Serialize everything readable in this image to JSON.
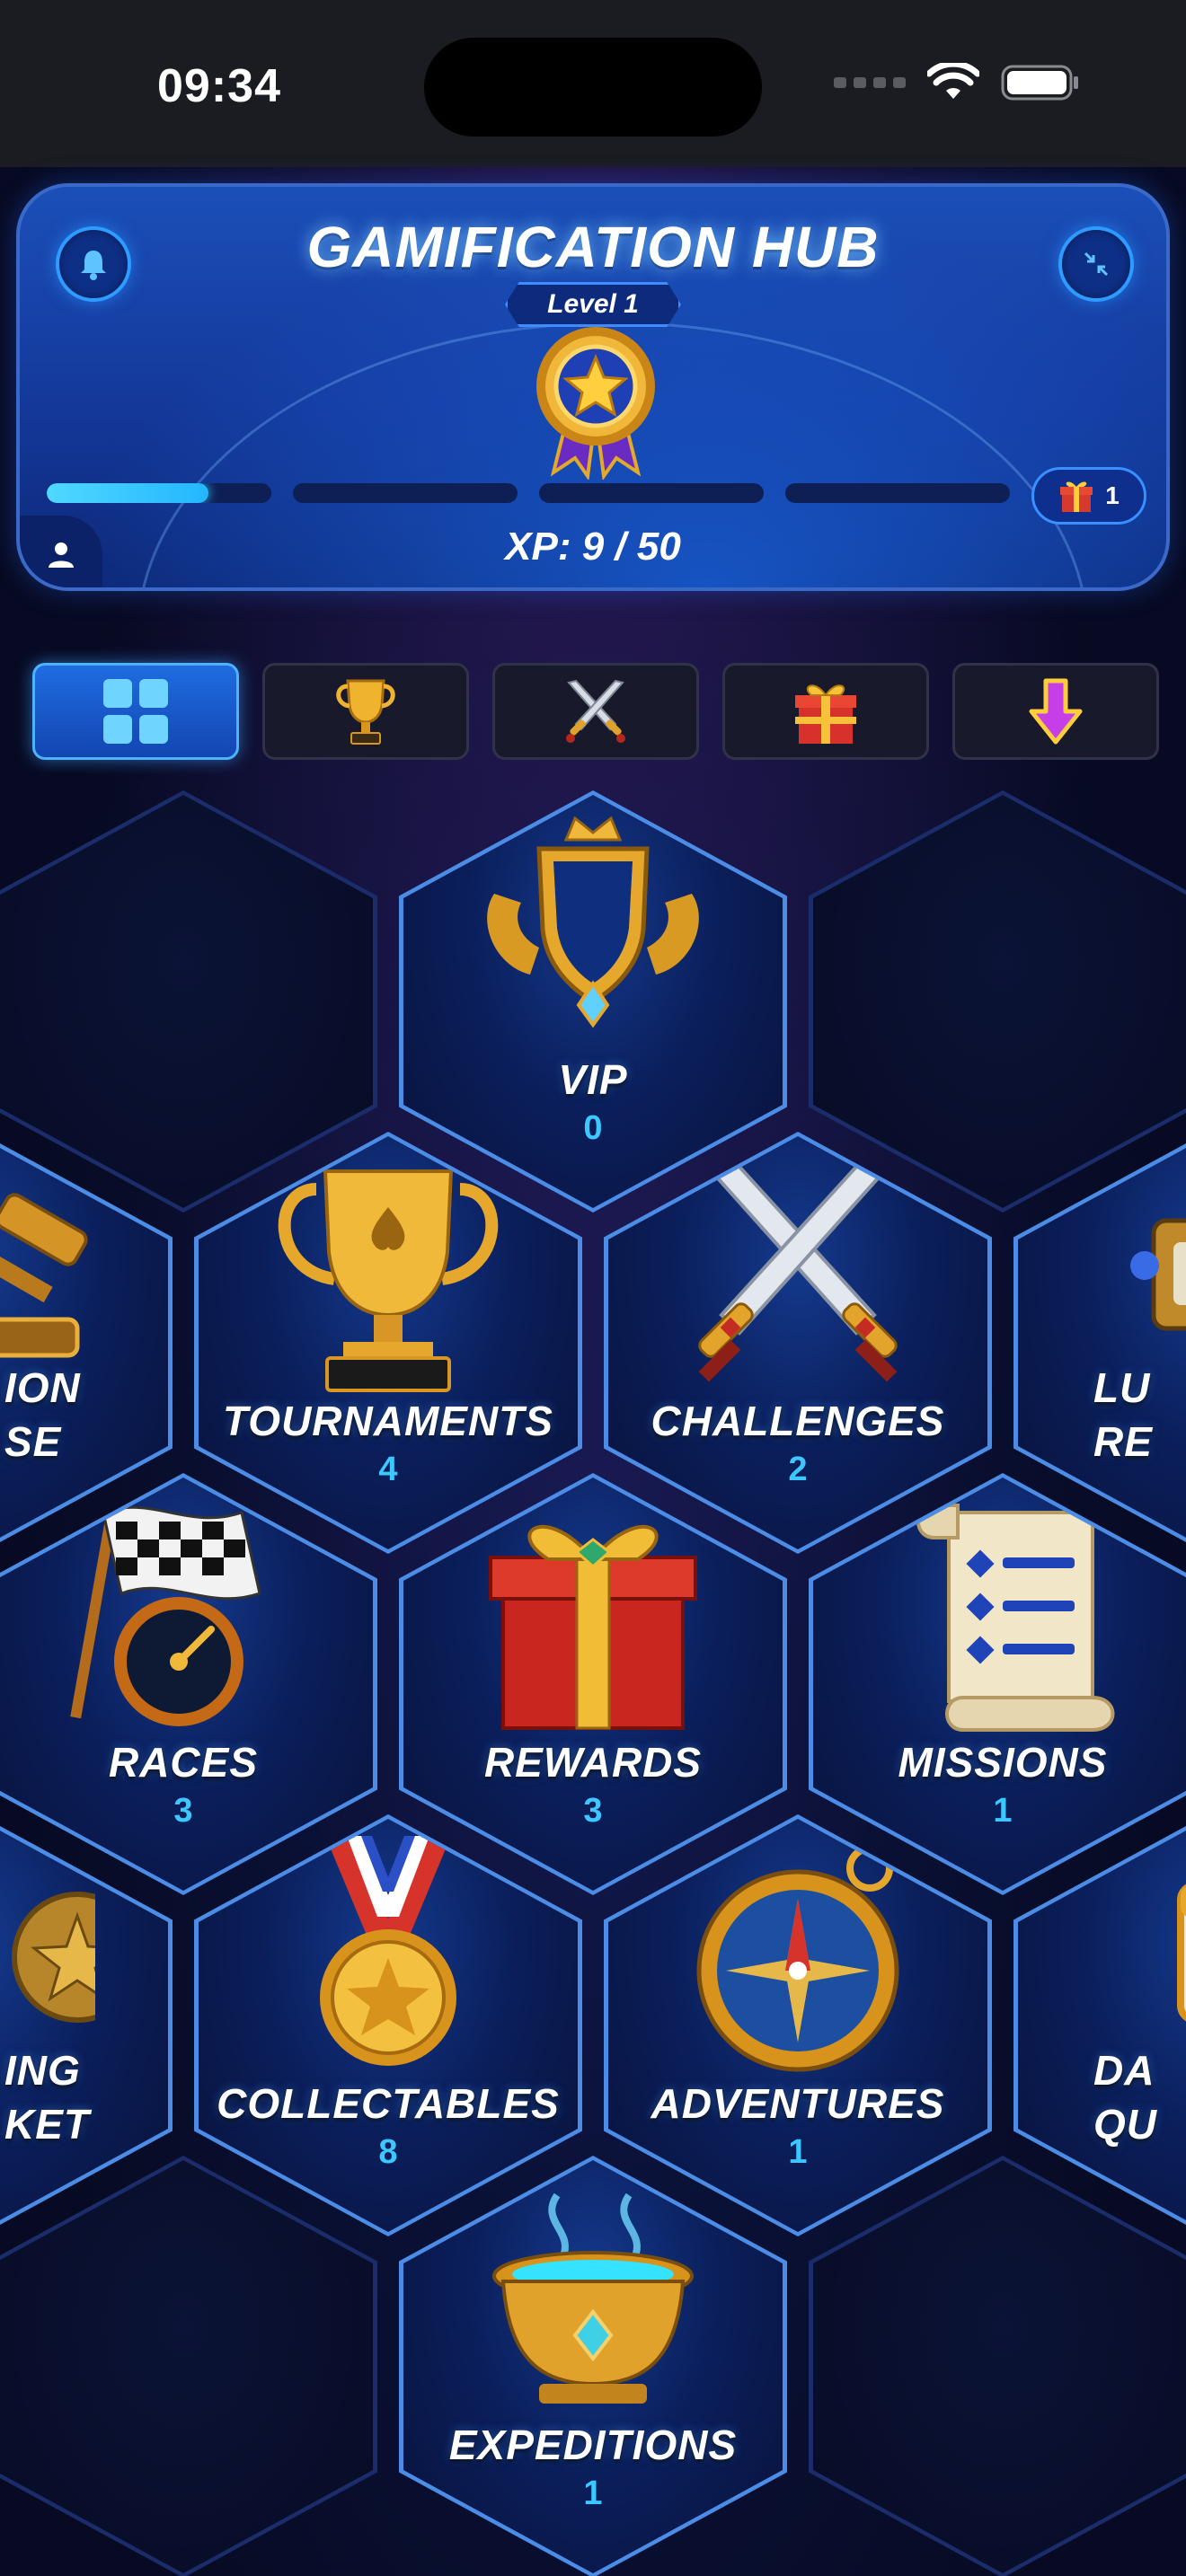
{
  "status_bar": {
    "time": "09:34"
  },
  "header": {
    "title": "GAMIFICATION HUB",
    "level_label": "Level 1",
    "xp_text": "XP: 9 / 50",
    "gift_count": "1",
    "progress_segments": [
      0.72,
      0,
      0,
      0
    ]
  },
  "tabs": [
    {
      "name": "tab-grid",
      "icon": "grid-icon",
      "active": true
    },
    {
      "name": "tab-trophy",
      "icon": "trophy-icon",
      "active": false
    },
    {
      "name": "tab-swords",
      "icon": "crossed-swords-icon",
      "active": false
    },
    {
      "name": "tab-gift",
      "icon": "gift-icon",
      "active": false
    },
    {
      "name": "tab-download",
      "icon": "down-arrow-icon",
      "active": false
    }
  ],
  "tiles": {
    "vip": {
      "label": "VIP",
      "count": "0"
    },
    "auction_left": {
      "label_line1": "ION",
      "label_line2": "SE"
    },
    "tournaments": {
      "label": "TOURNAMENTS",
      "count": "4"
    },
    "challenges": {
      "label": "CHALLENGES",
      "count": "2"
    },
    "lucky_right": {
      "label_line1": "LU",
      "label_line2": "RE"
    },
    "races": {
      "label": "RACES",
      "count": "3"
    },
    "rewards": {
      "label": "REWARDS",
      "count": "3"
    },
    "missions": {
      "label": "MISSIONS",
      "count": "1"
    },
    "coin_left": {
      "label_line1": "ING",
      "label_line2": "KET"
    },
    "collectables": {
      "label": "COLLECTABLES",
      "count": "8"
    },
    "adventures": {
      "label": "ADVENTURES",
      "count": "1"
    },
    "daily_right": {
      "label_line1": "DA",
      "label_line2": "QU"
    },
    "expeditions": {
      "label": "EXPEDITIONS",
      "count": "1"
    }
  }
}
